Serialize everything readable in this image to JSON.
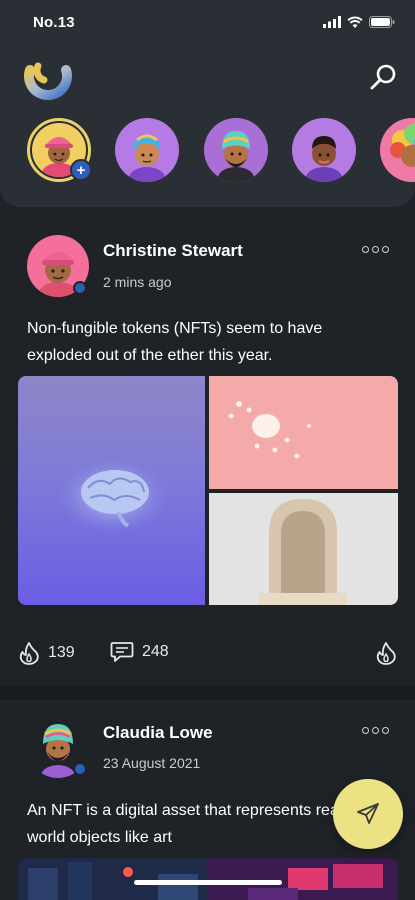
{
  "status_bar": {
    "time": "No.13"
  },
  "header": {
    "logo_icon": "app-logo-icon",
    "search_icon": "search-icon",
    "stories": [
      {
        "name": "my-story",
        "icon": "avatar-pink-hat",
        "is_mine": true
      },
      {
        "name": "story-2",
        "icon": "avatar-rainbow-hair"
      },
      {
        "name": "story-3",
        "icon": "avatar-turban-beard"
      },
      {
        "name": "story-4",
        "icon": "avatar-dark-hair"
      },
      {
        "name": "story-5",
        "icon": "avatar-rainbow-afro"
      }
    ]
  },
  "posts": [
    {
      "author": "Christine Stewart",
      "time": "2 mins ago",
      "text": "Non-fungible tokens (NFTs) seem to have exploded out of the ether this year.",
      "likes": "139",
      "comments": "248"
    },
    {
      "author": "Claudia Lowe",
      "time": "23 August 2021",
      "text": "An NFT is a digital asset that represents real-world objects like art"
    }
  ],
  "colors": {
    "background": "#1f2227",
    "header": "#2a2e35",
    "accent_blue": "#2c5fb8",
    "fab_yellow": "#ece183"
  }
}
